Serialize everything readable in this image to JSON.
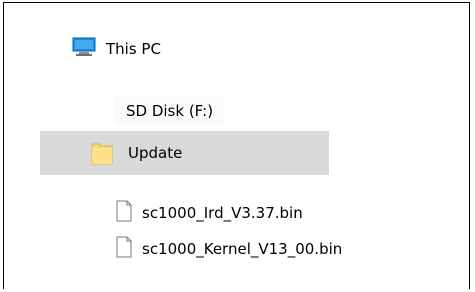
{
  "tree": {
    "this_pc": {
      "label": "This PC",
      "icon": "monitor-icon"
    },
    "drive": {
      "label": "SD Disk (F:)"
    },
    "folder": {
      "label": "Update",
      "icon": "folder-icon",
      "highlight": "#d9d9d9"
    },
    "files": [
      {
        "label": "sc1000_Ird_V3.37.bin",
        "icon": "file-icon"
      },
      {
        "label": "sc1000_Kernel_V13_00.bin",
        "icon": "file-icon"
      }
    ]
  }
}
